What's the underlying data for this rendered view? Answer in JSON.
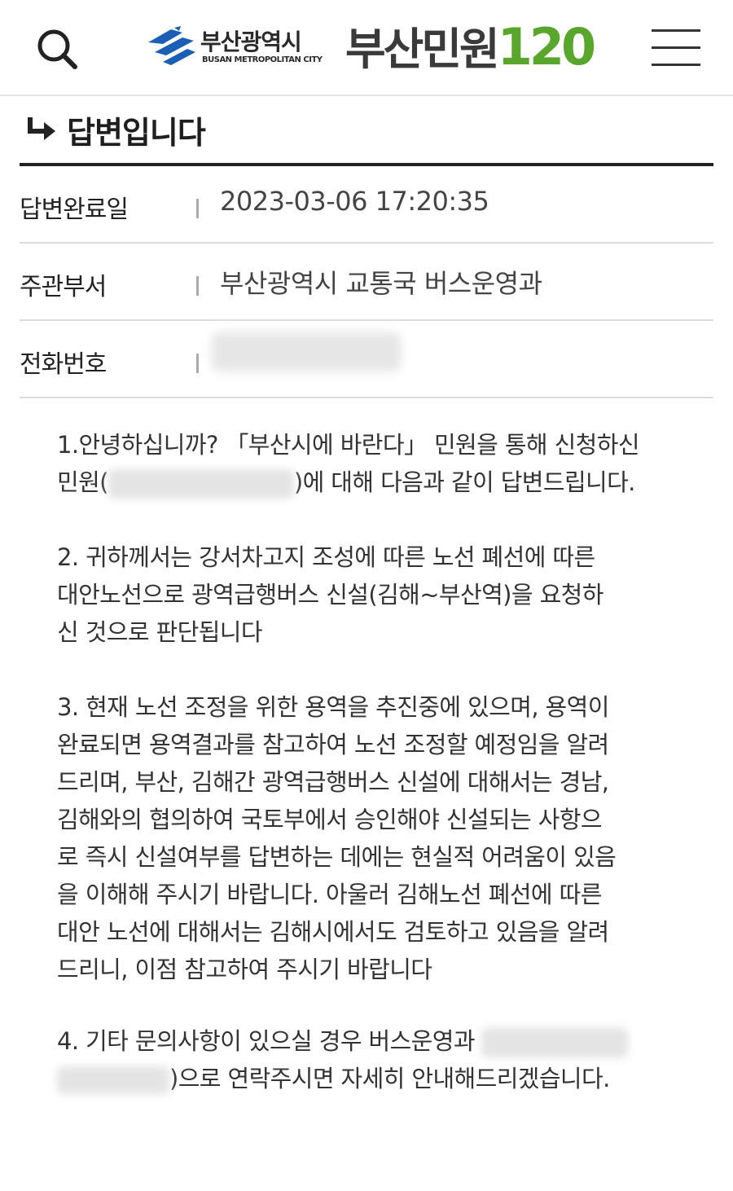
{
  "header": {
    "search_icon": "search-icon",
    "logo": {
      "city_name": "부산광역시",
      "city_name_en": "BUSAN METROPOLITAN CITY"
    },
    "service_name": "부산민원",
    "service_number": "120",
    "menu_icon": "hamburger-menu-icon",
    "brand_green": "#58a62c"
  },
  "section": {
    "title": "답변입니다",
    "arrow_icon": "return-arrow-icon"
  },
  "info": {
    "completed_date": {
      "label": "답변완료일",
      "value": "2023-03-06 17:20:35"
    },
    "department": {
      "label": "주관부서",
      "value": "부산광역시 교통국 버스운영과"
    },
    "phone": {
      "label": "전화번호",
      "value": ""
    }
  },
  "answer": {
    "p1": {
      "line1": "1.안녕하십니까? 「부산시에 바란다」 민원을 통해 신청하신",
      "line2_a": "민원(",
      "line2_b": ")에 대해 다음과 같이 답변드립니다."
    },
    "p2": {
      "line1": "2. 귀하께서는 강서차고지 조성에 따른 노선 폐선에 따른",
      "line2": "대안노선으로 광역급행버스 신설(김해~부산역)을 요청하",
      "line3": "신 것으로 판단됩니다"
    },
    "p3": {
      "line1": "3. 현재 노선 조정을 위한 용역을 추진중에 있으며, 용역이",
      "line2": "완료되면 용역결과를 참고하여 노선 조정할 예정임을 알려",
      "line3": "드리며, 부산, 김해간 광역급행버스 신설에 대해서는 경남,",
      "line4": "김해와의 협의하여 국토부에서 승인해야 신설되는 사항으",
      "line5": "로 즉시 신설여부를 답변하는 데에는 현실적 어려움이 있음",
      "line6": "을 이해해 주시기 바랍니다. 아울러 김해노선 폐선에 따른",
      "line7": "대안 노선에 대해서는 김해시에서도 검토하고 있음을 알려",
      "line8": "드리니, 이점 참고하여 주시기 바랍니다"
    },
    "p4": {
      "line1": "4. 기타 문의사항이 있으실 경우 버스운영과",
      "line2": ")으로 연락주시면 자세히 안내해드리겠습니다."
    }
  }
}
